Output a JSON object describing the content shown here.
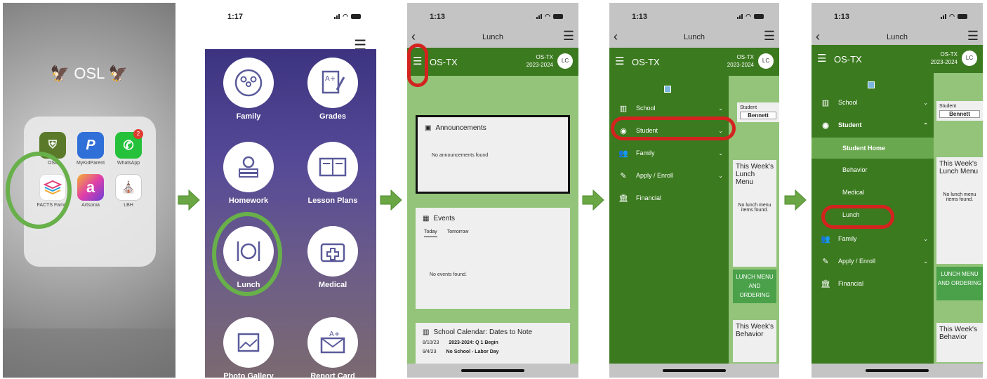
{
  "phone1": {
    "folder_title": "OSL",
    "apps": [
      {
        "label": "OSL",
        "icon": "osl-crest-icon",
        "color": "#5a7a2a"
      },
      {
        "label": "MyKidParent",
        "icon": "p-letter-icon",
        "color": "#2f6fd8"
      },
      {
        "label": "WhatsApp",
        "icon": "whatsapp-icon",
        "color": "#25c13b",
        "badge": "2"
      },
      {
        "label": "FACTS Family",
        "icon": "facts-layers-icon",
        "color": "#ffffff"
      },
      {
        "label": "Artsonia",
        "icon": "artsonia-a-icon",
        "color": "#e13fa8"
      },
      {
        "label": "LBH",
        "icon": "lbh-seal-icon",
        "color": "#ffffff"
      }
    ],
    "highlight_color": "#68b04a"
  },
  "phone2": {
    "time": "1:17",
    "tiles": [
      "Family",
      "Grades",
      "Homework",
      "Lesson Plans",
      "Lunch",
      "Medical",
      "Photo Gallery",
      "Report Card"
    ]
  },
  "phone3": {
    "time": "1:13",
    "title": "Lunch",
    "school": "OS-TX",
    "school_code": "OS-TX",
    "year": "2023-2024",
    "avatar": "LC",
    "announcements_title": "Announcements",
    "announcements_empty": "No announcements found",
    "events_title": "Events",
    "tabs": [
      "Today",
      "Tomorrow"
    ],
    "events_empty": "No events found.",
    "calendar_title": "School Calendar: Dates to Note",
    "calendar_rows": [
      {
        "date": "8/10/23",
        "text": "2023-2024: Q 1 Begin"
      },
      {
        "date": "9/4/23",
        "text": "No School - Labor Day"
      }
    ]
  },
  "phone4": {
    "time": "1:13",
    "title": "Lunch",
    "school": "OS-TX",
    "school_code": "OS-TX",
    "year": "2023-2024",
    "avatar": "LC",
    "menu": [
      "School",
      "Student",
      "Family",
      "Apply / Enroll",
      "Financial"
    ],
    "student_label": "Student",
    "student_name": "Bennett",
    "lunch_card": "This Week's Lunch Menu",
    "lunch_empty": "No lunch menu items found.",
    "lunch_button": "LUNCH MENU AND ORDERING",
    "behavior_card": "This Week's Behavior"
  },
  "phone5": {
    "time": "1:13",
    "title": "Lunch",
    "school": "OS-TX",
    "school_code": "OS-TX",
    "year": "2023-2024",
    "avatar": "LC",
    "menu": [
      "School",
      "Student",
      "Student Home",
      "Behavior",
      "Medical",
      "Lunch",
      "Family",
      "Apply / Enroll",
      "Financial"
    ],
    "student_label": "Student",
    "student_name": "Bennett",
    "lunch_card": "This Week's Lunch Menu",
    "lunch_empty": "No lunch menu items found.",
    "lunch_button": "LUNCH MENU AND ORDERING",
    "behavior_card": "This Week's Behavior"
  },
  "colors": {
    "arrow": "#6aa744",
    "header_green": "#3b7a1f",
    "light_green": "#93c47a",
    "red_mark": "#d4231f"
  }
}
